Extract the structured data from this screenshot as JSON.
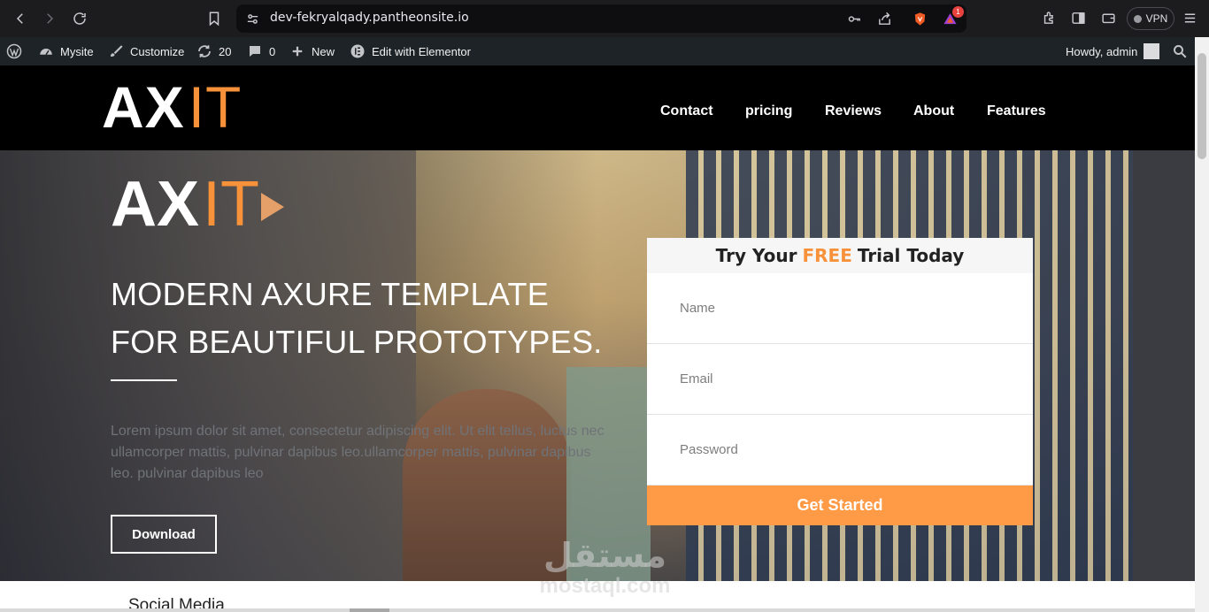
{
  "browser": {
    "url": "dev-fekryalqady.pantheonsite.io",
    "vpn_label": "VPN",
    "notification_count": "1"
  },
  "wp_admin_bar": {
    "site_name": "Mysite",
    "customize": "Customize",
    "updates_count": "20",
    "comments_count": "0",
    "new": "New",
    "edit_elementor": "Edit with Elementor",
    "howdy": "Howdy, admin"
  },
  "header": {
    "logo_left": "AX",
    "logo_right": "IT",
    "menu": [
      {
        "label": "Contact"
      },
      {
        "label": "pricing"
      },
      {
        "label": "Reviews"
      },
      {
        "label": "About"
      },
      {
        "label": "Features"
      }
    ]
  },
  "hero": {
    "logo_left": "AX",
    "logo_right": "IT",
    "title_line1": "MODERN AXURE TEMPLATE",
    "title_line2": "FOR BEAUTIFUL PROTOTYPES.",
    "body": "Lorem ipsum dolor sit amet, consectetur adipiscing elit. Ut elit tellus, luctus nec ullamcorper mattis, pulvinar dapibus leo.ullamcorper mattis, pulvinar dapibus leo. pulvinar dapibus leo",
    "download_label": "Download"
  },
  "form": {
    "title_before": "Try Your",
    "title_highlight": "FREE",
    "title_after": "Trial Today",
    "name_placeholder": "Name",
    "email_placeholder": "Email",
    "password_placeholder": "Password",
    "submit_label": "Get Started"
  },
  "below": {
    "social_title": "Social Media"
  },
  "watermark": {
    "arabic": "مستقل",
    "latin": "mostaql.com"
  },
  "colors": {
    "accent": "#f7923a",
    "button": "#ff9a47",
    "header_bg": "#000000",
    "wpbar_bg": "#1d2327"
  }
}
